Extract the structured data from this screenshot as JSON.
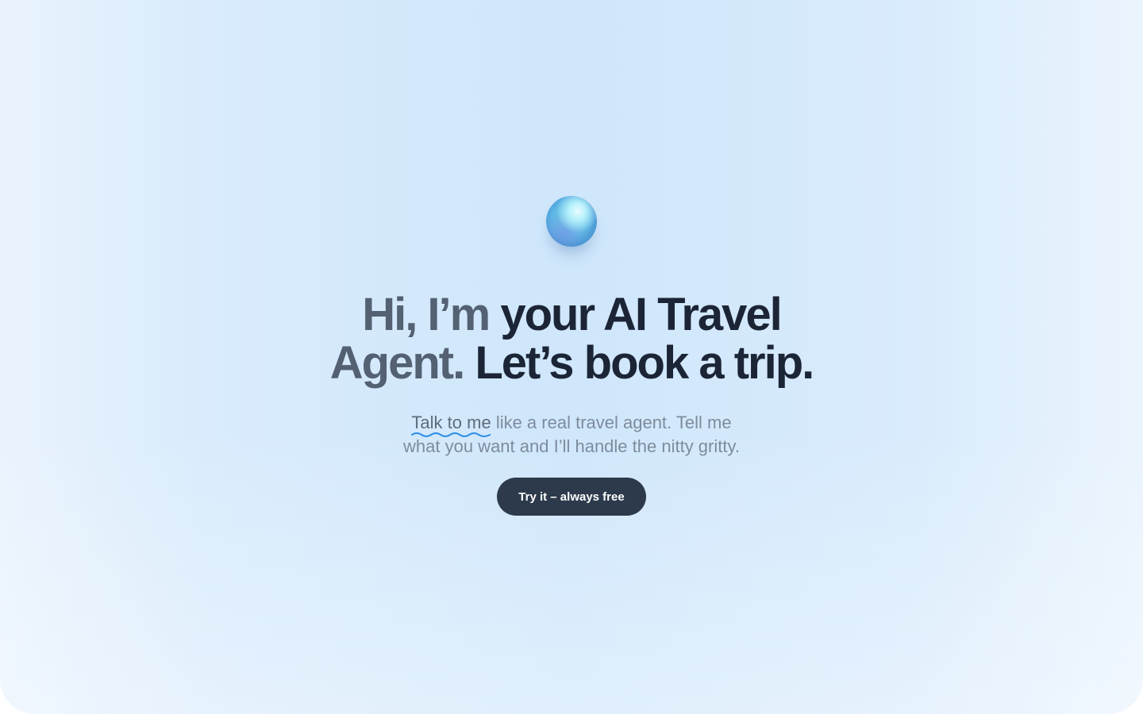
{
  "hero": {
    "headline_muted_1": "Hi, I’m",
    "headline_strong_1": "your AI Travel",
    "headline_muted_2": "Agent.",
    "headline_strong_2": "Let’s book a trip.",
    "subtitle_link": "Talk to me",
    "subtitle_rest_1": "like a real travel agent. Tell me",
    "subtitle_rest_2": "what you want and I’ll handle the nitty gritty.",
    "cta_label": "Try it – always free"
  },
  "colors": {
    "cta_bg": "#2c3a4c",
    "headline": "#1b2536",
    "headline_muted": "#536173",
    "squiggle": "#2f8ee6"
  },
  "icons": {
    "logo": "globe-orb-icon"
  }
}
